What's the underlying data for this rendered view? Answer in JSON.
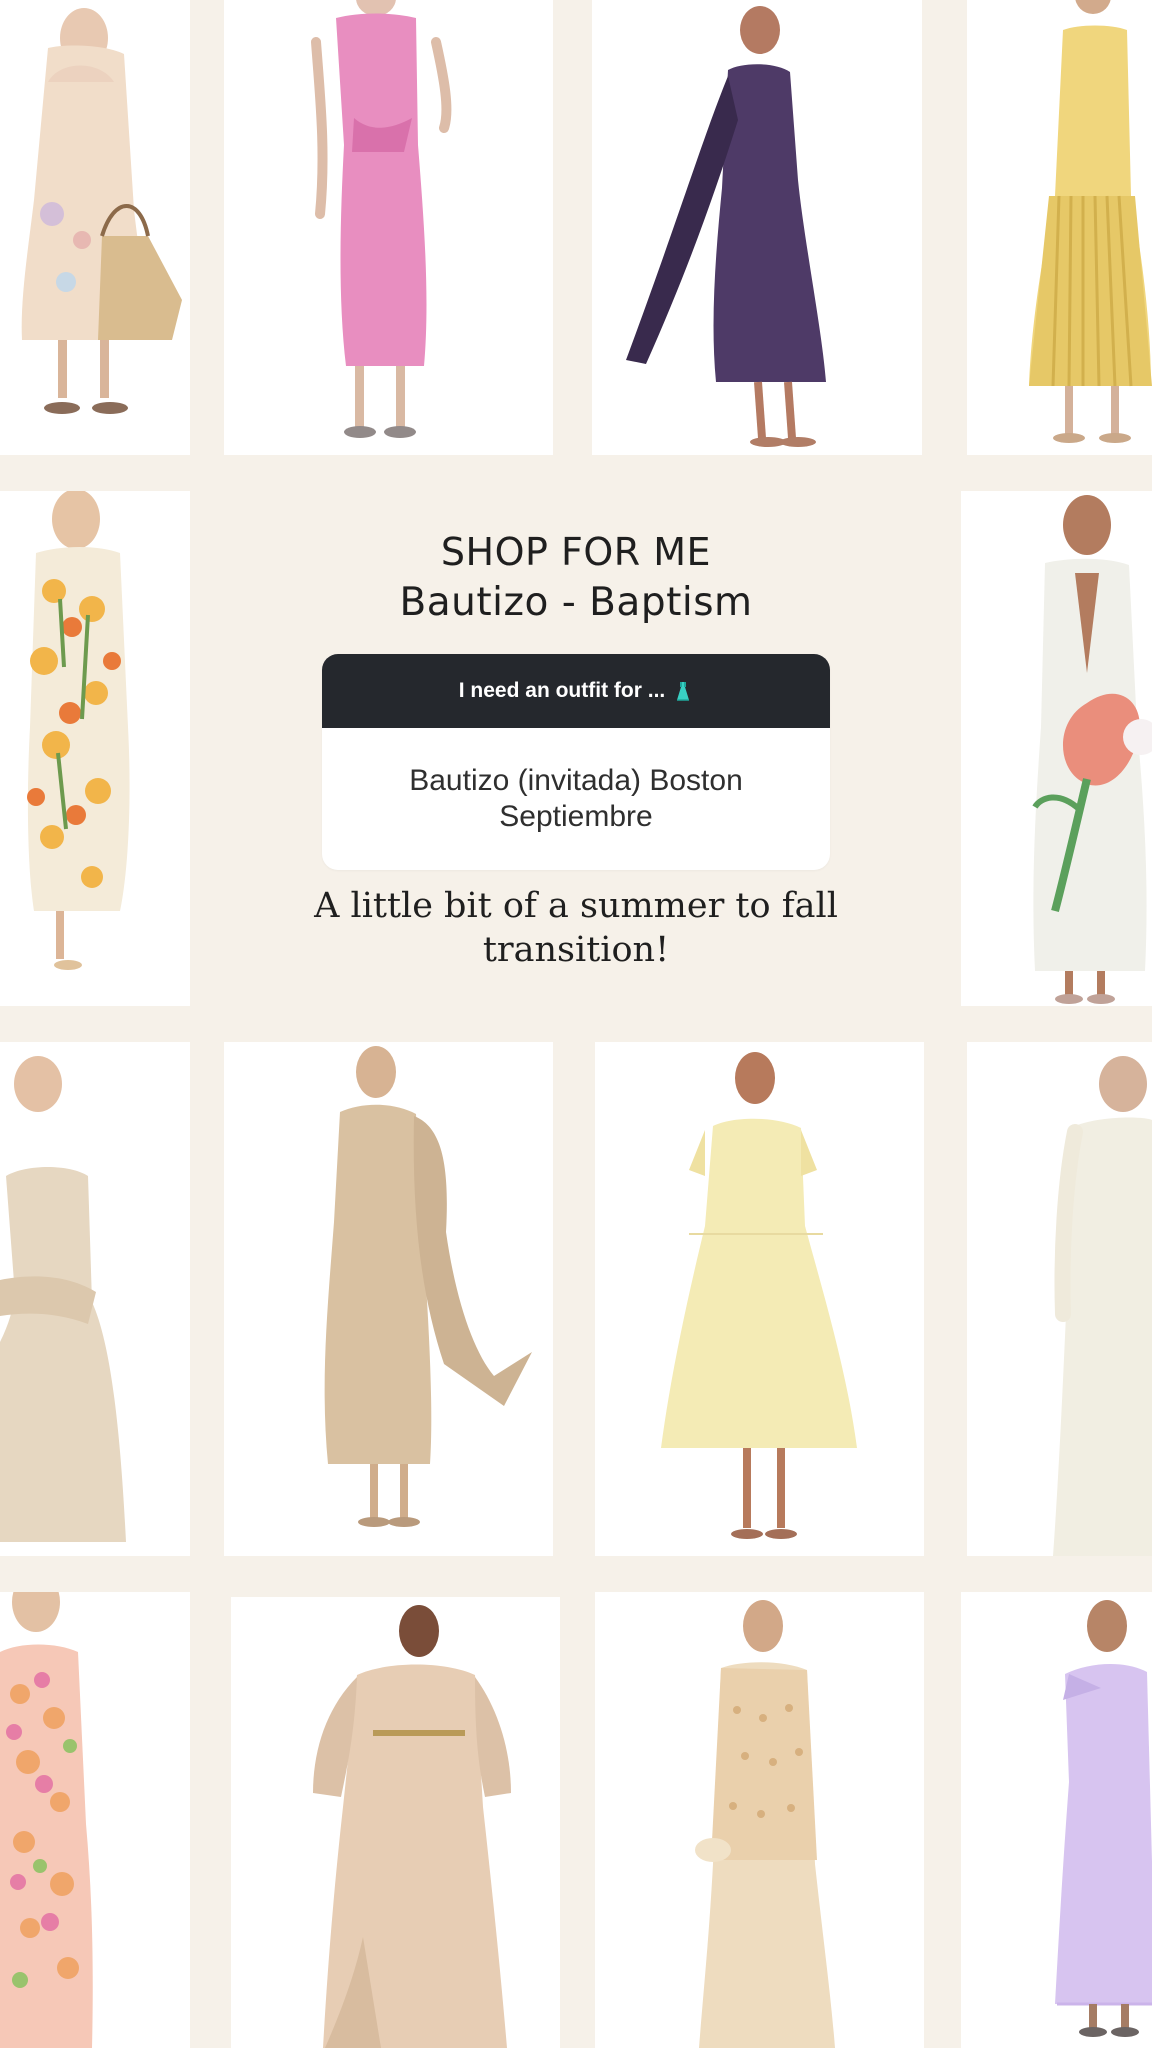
{
  "title": {
    "line1": "SHOP FOR ME",
    "line2": "Bautizo - Baptism"
  },
  "question_card": {
    "prompt": "I need an outfit for ...",
    "prompt_icon": "dress-icon",
    "answer": "Bautizo (invitada) Boston Septiembre"
  },
  "caption": "A little bit of a summer to fall transition!",
  "colors": {
    "background": "#f6f1e9",
    "card_header": "#25282d",
    "card_body": "#ffffff",
    "text": "#1f1f1f"
  },
  "products": [
    {
      "name": "floral-cutout-dress",
      "color": "#f1ddc9"
    },
    {
      "name": "pink-draped-sheath-dress",
      "color": "#e88ec0"
    },
    {
      "name": "purple-satin-scarf-dress",
      "color": "#4e3a67"
    },
    {
      "name": "yellow-pleated-dress",
      "color": "#f0d67d"
    },
    {
      "name": "tulip-print-strapless-dress",
      "color": "#f2b54a"
    },
    {
      "name": "white-floral-halter-gown",
      "color": "#f0f0ea"
    },
    {
      "name": "ivory-peplum-gown",
      "color": "#e6d7c1"
    },
    {
      "name": "champagne-cape-dress",
      "color": "#d9c1a1"
    },
    {
      "name": "butter-midi-dress",
      "color": "#f4ebb5"
    },
    {
      "name": "cream-knit-gown",
      "color": "#f1eee2"
    },
    {
      "name": "peach-lace-dress",
      "color": "#f6c8b7"
    },
    {
      "name": "nude-satin-kaftan",
      "color": "#e7cdb4"
    },
    {
      "name": "beige-beaded-gown",
      "color": "#eedcbf"
    },
    {
      "name": "lilac-asymmetric-dress",
      "color": "#d7c4f0"
    }
  ]
}
